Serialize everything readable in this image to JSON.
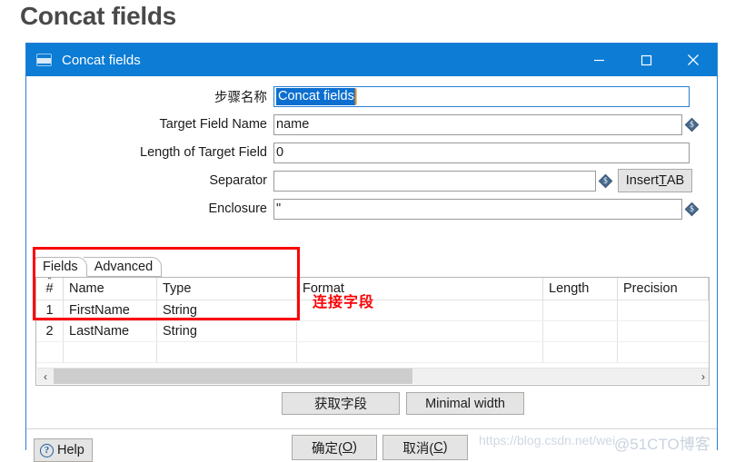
{
  "page": {
    "heading": "Concat fields"
  },
  "dialog": {
    "titlebar": {
      "icon": "window-icon",
      "title": "Concat fields",
      "minimize": "─",
      "maximize": "□",
      "close": "✕"
    },
    "form": [
      {
        "label": "步骤名称",
        "value": "Concat fields",
        "placeholder": "",
        "focused": true,
        "selected": true,
        "has_variable_icon": false
      },
      {
        "label": "Target Field Name",
        "value": "name",
        "placeholder": "",
        "focused": false,
        "selected": false,
        "has_variable_icon": true
      },
      {
        "label": "Length of Target Field",
        "value": "0",
        "placeholder": "",
        "focused": false,
        "selected": false,
        "has_variable_icon": false
      },
      {
        "label": "Separator",
        "value": "",
        "placeholder": "",
        "focused": false,
        "selected": false,
        "has_variable_icon": true
      },
      {
        "label": "Enclosure",
        "value": "\"",
        "placeholder": "",
        "focused": false,
        "selected": false,
        "has_variable_icon": true
      }
    ],
    "variable_icon_glyph": "$",
    "insert_tab_button": {
      "prefix": "Insert ",
      "mnemonic": "T",
      "suffix": "AB"
    },
    "tabs": [
      {
        "label": "Fields",
        "active": true
      },
      {
        "label": "Advanced",
        "active": false
      }
    ],
    "table": {
      "columns": [
        "#",
        "Name",
        "Type",
        "Format",
        "Length",
        "Precision"
      ],
      "sort_indicator": "⌃",
      "rows": [
        {
          "num": "1",
          "name": "FirstName",
          "type": "String",
          "format": "",
          "length": "",
          "precision": ""
        },
        {
          "num": "2",
          "name": "LastName",
          "type": "String",
          "format": "",
          "length": "",
          "precision": ""
        },
        {
          "num": "",
          "name": "",
          "type": "",
          "format": "",
          "length": "",
          "precision": ""
        }
      ],
      "scrollbar": {
        "left_arrow": "‹",
        "right_arrow": "›",
        "thumb_start_pct": 0,
        "thumb_width_pct": 56
      }
    },
    "mid_buttons": [
      {
        "label": "获取字段"
      },
      {
        "label": "Minimal width"
      }
    ],
    "footer": {
      "help": {
        "icon": "question-circle-icon",
        "label": "Help"
      },
      "ok": {
        "prefix": "确定(",
        "mnemonic": "O",
        "suffix": ")"
      },
      "cancel": {
        "prefix": "取消(",
        "mnemonic": "C",
        "suffix": ")"
      }
    }
  },
  "annotations": {
    "highlight_box_color": "#fa0205",
    "note_text": "连接字段"
  },
  "watermarks": {
    "csdn": "https://blog.csdn.net/wei",
    "cto": "@51CTO博客"
  },
  "colors": {
    "titlebar_blue": "#0c7cd5",
    "dialog_border": "#2a7fd4",
    "selection_blue": "#0c6fd0",
    "annotation_red": "#fa0205",
    "button_face": "#e4e4e4"
  }
}
